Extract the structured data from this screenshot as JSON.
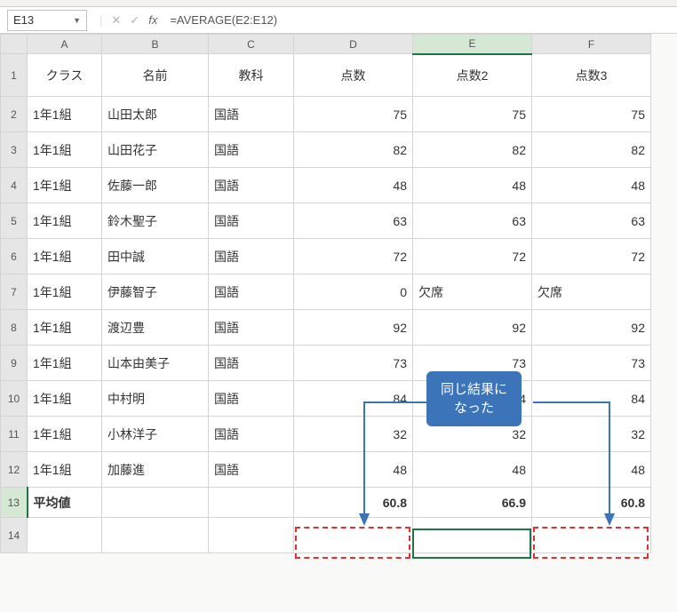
{
  "namebox": "E13",
  "formula": "=AVERAGE(E2:E12)",
  "columns": [
    "A",
    "B",
    "C",
    "D",
    "E",
    "F"
  ],
  "headers": {
    "A": "クラス",
    "B": "名前",
    "C": "教科",
    "D": "点数",
    "E": "点数2",
    "F": "点数3"
  },
  "rows": [
    {
      "A": "1年1組",
      "B": "山田太郎",
      "C": "国語",
      "D": "75",
      "E": "75",
      "F": "75"
    },
    {
      "A": "1年1組",
      "B": "山田花子",
      "C": "国語",
      "D": "82",
      "E": "82",
      "F": "82"
    },
    {
      "A": "1年1組",
      "B": "佐藤一郎",
      "C": "国語",
      "D": "48",
      "E": "48",
      "F": "48"
    },
    {
      "A": "1年1組",
      "B": "鈴木聖子",
      "C": "国語",
      "D": "63",
      "E": "63",
      "F": "63"
    },
    {
      "A": "1年1組",
      "B": "田中誠",
      "C": "国語",
      "D": "72",
      "E": "72",
      "F": "72"
    },
    {
      "A": "1年1組",
      "B": "伊藤智子",
      "C": "国語",
      "D": "0",
      "E": "欠席",
      "F": "欠席",
      "Etxt": true,
      "Ftxt": true
    },
    {
      "A": "1年1組",
      "B": "渡辺豊",
      "C": "国語",
      "D": "92",
      "E": "92",
      "F": "92"
    },
    {
      "A": "1年1組",
      "B": "山本由美子",
      "C": "国語",
      "D": "73",
      "E": "73",
      "F": "73"
    },
    {
      "A": "1年1組",
      "B": "中村明",
      "C": "国語",
      "D": "84",
      "E": "84",
      "F": "84"
    },
    {
      "A": "1年1組",
      "B": "小林洋子",
      "C": "国語",
      "D": "32",
      "E": "32",
      "F": "32"
    },
    {
      "A": "1年1組",
      "B": "加藤進",
      "C": "国語",
      "D": "48",
      "E": "48",
      "F": "48"
    }
  ],
  "avg": {
    "label": "平均値",
    "D": "60.8",
    "E": "66.9",
    "F": "60.8"
  },
  "callout": "同じ結果に\nなった"
}
